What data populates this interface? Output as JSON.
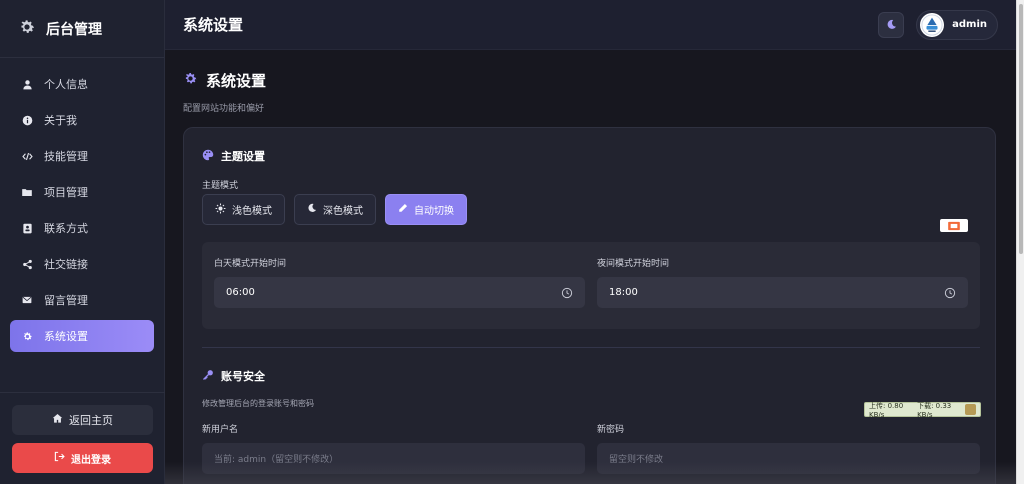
{
  "sidebar": {
    "brand": "后台管理",
    "items": [
      {
        "label": "个人信息",
        "icon": "user-icon"
      },
      {
        "label": "关于我",
        "icon": "info-icon"
      },
      {
        "label": "技能管理",
        "icon": "code-icon"
      },
      {
        "label": "项目管理",
        "icon": "folder-icon"
      },
      {
        "label": "联系方式",
        "icon": "contact-card-icon"
      },
      {
        "label": "社交链接",
        "icon": "share-icon"
      },
      {
        "label": "留言管理",
        "icon": "envelope-icon"
      },
      {
        "label": "系统设置",
        "icon": "gear-icon",
        "active": true
      }
    ],
    "home_label": "返回主页",
    "logout_label": "退出登录"
  },
  "header": {
    "title": "系统设置",
    "user_name": "admin"
  },
  "page": {
    "title": "系统设置",
    "subtitle": "配置网站功能和偏好"
  },
  "theme": {
    "section_title": "主题设置",
    "mode_label": "主题模式",
    "modes": [
      "浅色模式",
      "深色模式",
      "自动切换"
    ],
    "selected_mode": "自动切换",
    "day_label": "白天模式开始时间",
    "day_value": "06:00",
    "night_label": "夜间模式开始时间",
    "night_value": "18:00"
  },
  "account": {
    "section_title": "账号安全",
    "subtitle": "修改管理后台的登录账号和密码",
    "username_label": "新用户名",
    "username_placeholder": "当前: admin（留空则不修改）",
    "password_label": "新密码",
    "password_placeholder": "留空则不修改"
  },
  "overlay": {
    "upload": "上传: 0.80 KB/s",
    "download": "下载: 0.33 KB/s"
  },
  "colors": {
    "accent": "#8b80f0",
    "danger": "#ea4a4a",
    "sidebar_bg": "#1f2230",
    "card_bg": "#22232f"
  }
}
